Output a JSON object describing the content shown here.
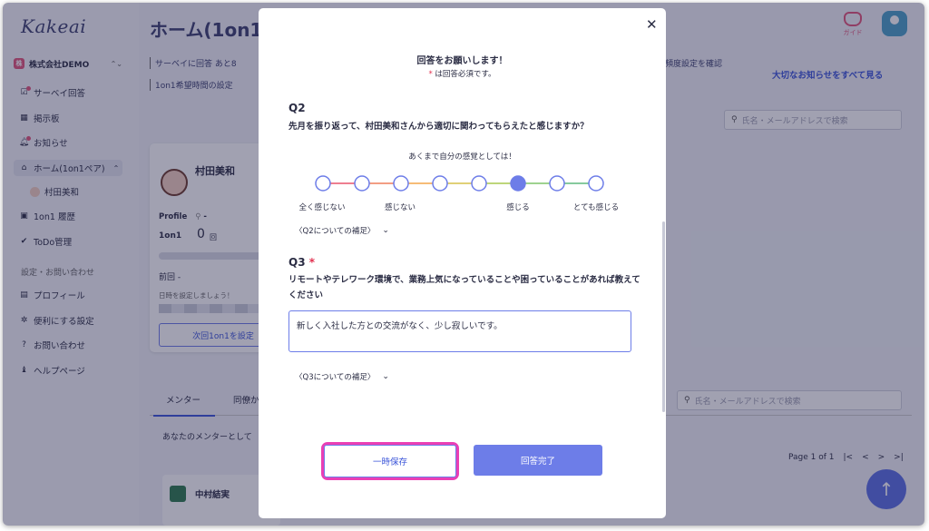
{
  "app": {
    "logo": "Kakeai",
    "company": "株式会社DEMO",
    "company_badge": "株",
    "page_title": "ホーム(1on1",
    "guide_label": "ガイド"
  },
  "sidebar": {
    "items": [
      {
        "label": "サーベイ回答"
      },
      {
        "label": "掲示板"
      },
      {
        "label": "お知らせ"
      },
      {
        "label": "ホーム(1on1ペア)"
      },
      {
        "label": "村田美和"
      },
      {
        "label": "1on1 履歴"
      },
      {
        "label": "ToDo管理"
      }
    ],
    "section_label": "設定・お問い合わせ",
    "settings": [
      {
        "label": "プロフィール"
      },
      {
        "label": "便利にする設定"
      },
      {
        "label": "お問い合わせ"
      },
      {
        "label": "ヘルプページ"
      }
    ]
  },
  "header": {
    "links": [
      "サーベイに回答 あと8",
      "1on1希望時間の設定"
    ],
    "freq_link": "頻度設定を確認",
    "notice_link": "大切なお知らせをすべて見る",
    "search_placeholder": "氏名・メールアドレスで検索"
  },
  "card": {
    "name": "村田美和",
    "profile_label": "Profile",
    "profile_value": "-",
    "oneon1_label": "1on1",
    "count": "0",
    "count_unit": "回",
    "prev_label": "前回 -",
    "hint": "日時を設定しましょう！",
    "set_button": "次回1on1を設定"
  },
  "tabs": {
    "mentor": "メンター",
    "colleague": "同僚か"
  },
  "mentor": {
    "text": "あなたのメンターとして",
    "name": "中村結実"
  },
  "pager": {
    "text": "Page 1 of 1",
    "first": "|<",
    "prev": "<",
    "next": ">",
    "last": ">|"
  },
  "modal": {
    "close": "✕",
    "title": "回答をお願いします！",
    "required_star": "*",
    "required_note": "は回答必須です。",
    "q2": {
      "label": "Q2",
      "text": "先月を振り返って、村田美和さんから適切に関わってもらえたと感じますか？",
      "note": "あくまで自分の感覚としては！",
      "scale_labels": [
        "全く感じない",
        "感じない",
        "感じる",
        "とても感じる"
      ],
      "scale_points": 8,
      "selected_point": 6,
      "supplement": "〈Q2についての補足〉"
    },
    "q3": {
      "label": "Q3",
      "required_star": "*",
      "text": "リモートやテレワーク環境で、業務上気になっていることや困っていることがあれば教えてください",
      "answer": "新しく入社した方との交流がなく、少し寂しいです。",
      "supplement": "〈Q3についての補足〉"
    },
    "save_button": "一時保存",
    "submit_button": "回答完了"
  }
}
